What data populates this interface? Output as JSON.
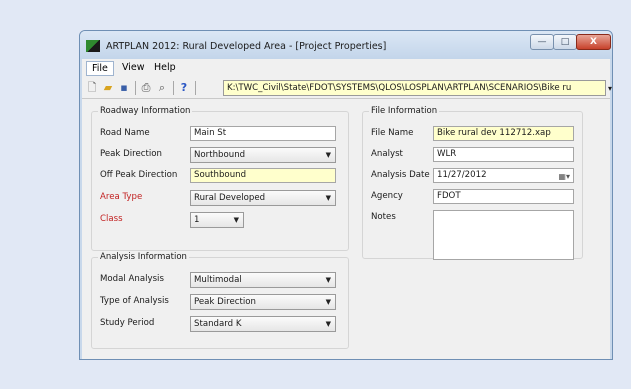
{
  "window": {
    "title": "ARTPLAN 2012: Rural Developed Area - [Project Properties]",
    "min_glyph": "—",
    "max_glyph": "□",
    "close_glyph": "X"
  },
  "menu": {
    "file": "File",
    "view": "View",
    "help": "Help"
  },
  "toolbar": {
    "path": "K:\\TWC_Civil\\State\\FDOT\\SYSTEMS\\QLOS\\LOSPLAN\\ARTPLAN\\SCENARIOS\\Bike ru",
    "icons": [
      "new-icon",
      "open-icon",
      "save-icon",
      "print-icon",
      "print-preview-icon",
      "help-icon"
    ]
  },
  "roadway": {
    "title": "Roadway Information",
    "road_name_label": "Road Name",
    "road_name_value": "Main St",
    "peak_direction_label": "Peak Direction",
    "peak_direction_value": "Northbound",
    "off_peak_label": "Off Peak Direction",
    "off_peak_value": "Southbound",
    "area_type_label": "Area Type",
    "area_type_value": "Rural Developed",
    "class_label": "Class",
    "class_value": "1"
  },
  "analysis": {
    "title": "Analysis Information",
    "modal_label": "Modal Analysis",
    "modal_value": "Multimodal",
    "type_label": "Type of Analysis",
    "type_value": "Peak Direction",
    "period_label": "Study Period",
    "period_value": "Standard K"
  },
  "file_info": {
    "title": "File Information",
    "file_name_label": "File Name",
    "file_name_value": "Bike rural dev 112712.xap",
    "analyst_label": "Analyst",
    "analyst_value": "WLR",
    "date_label": "Analysis Date",
    "date_value": "11/27/2012",
    "agency_label": "Agency",
    "agency_value": "FDOT",
    "notes_label": "Notes",
    "notes_value": ""
  },
  "colors": {
    "required_label": "#c22121",
    "highlight_field": "#ffffcc"
  }
}
